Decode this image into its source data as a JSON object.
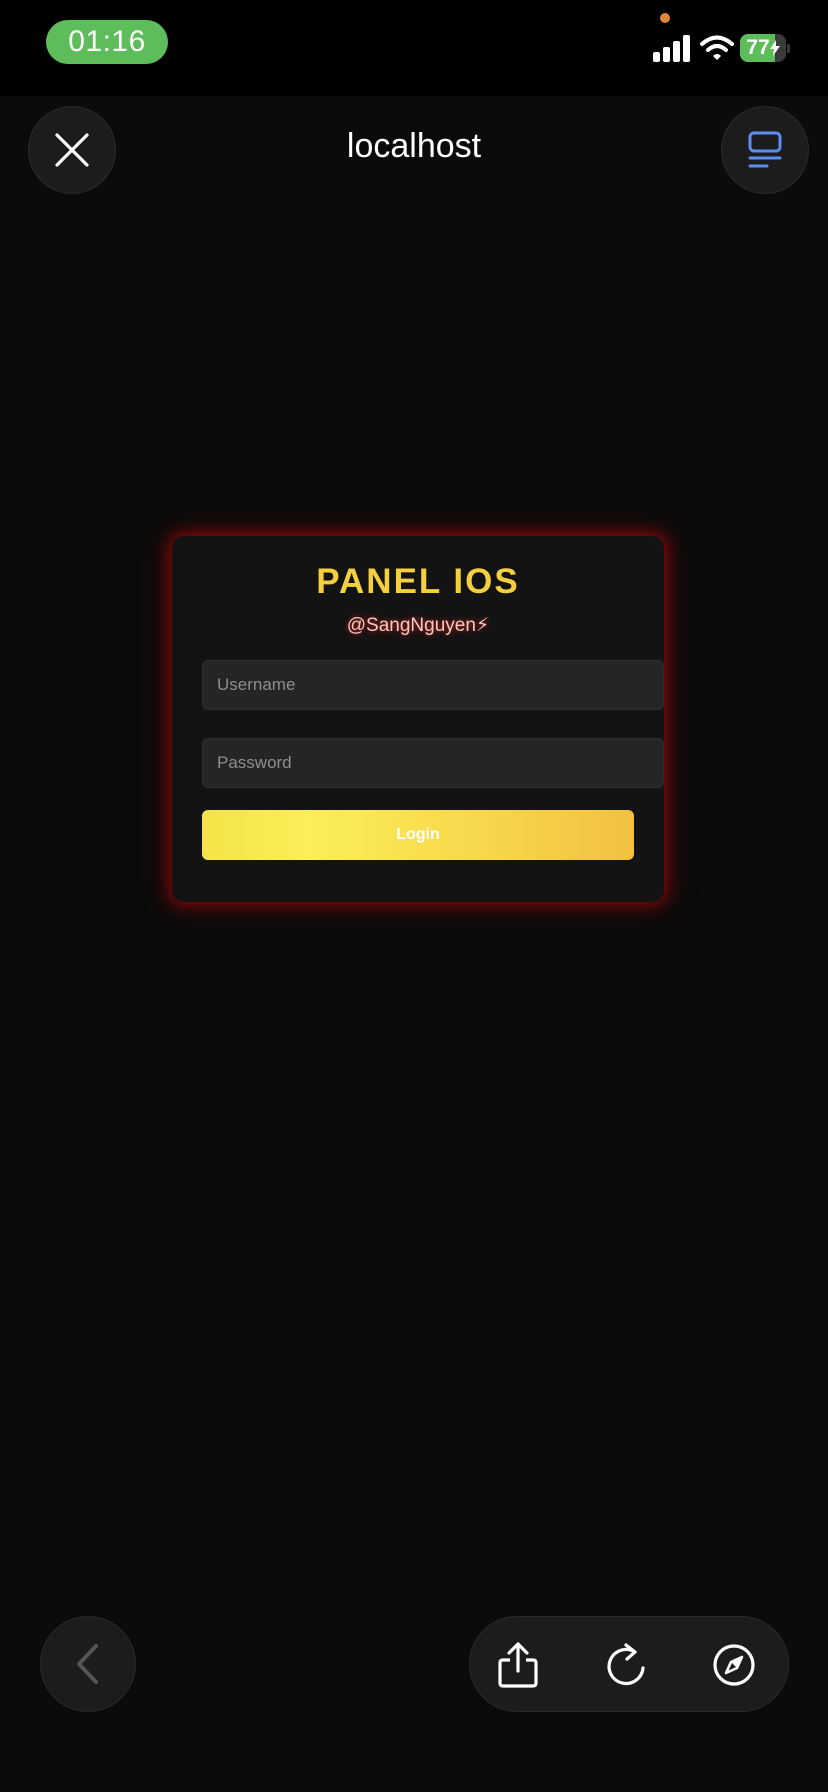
{
  "status_bar": {
    "time": "01:16",
    "battery_text": "77",
    "battery_level": 0.77,
    "icons": [
      "signal-icon",
      "wifi-icon",
      "battery-icon",
      "charging-bolt-icon"
    ]
  },
  "browser": {
    "url_title": "localhost",
    "icons": [
      "close-icon",
      "tabs-icon",
      "chevron-left-icon",
      "share-icon",
      "reload-icon",
      "compass-icon"
    ]
  },
  "login_card": {
    "title": "PANEL IOS",
    "handle": "@SangNguyen⚡",
    "username_placeholder": "Username",
    "password_placeholder": "Password",
    "login_label": "Login"
  },
  "colors": {
    "title_yellow": "#f4d03f",
    "button_gradient_start": "#f5e34a",
    "button_gradient_end": "#f2c140",
    "card_glow": "#a00a0a",
    "time_pill_green": "#5dbd5a",
    "tabs_icon_blue": "#5b8def"
  }
}
